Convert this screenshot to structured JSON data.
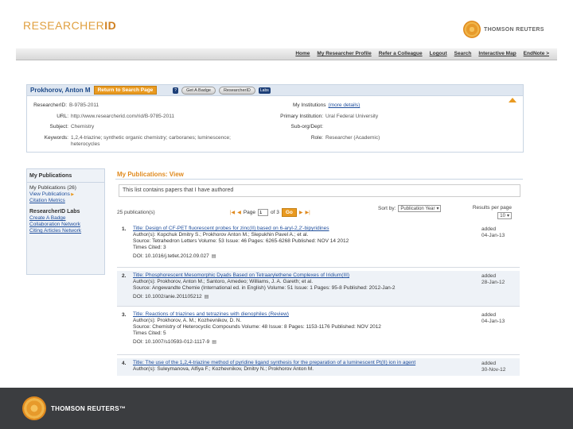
{
  "header": {
    "logo_light": "RESEARCHER",
    "logo_bold": "ID",
    "brand": "THOMSON REUTERS"
  },
  "nav": [
    "Home",
    "My Researcher Profile",
    "Refer a Colleague",
    "Logout",
    "Search",
    "Interactive Map",
    "EndNote >"
  ],
  "profile": {
    "name": "Prokhorov, Anton M",
    "return_button": "Return to Search Page",
    "badge_button": "Get A Badge",
    "download_button": "ResearcherID",
    "labs_label": "Labs",
    "researcher_id_label": "ResearcherID:",
    "researcher_id": "B-9785-2011",
    "url_label": "URL:",
    "url": "http://www.researcherid.com/rid/B-9785-2011",
    "subject_label": "Subject:",
    "subject": "Chemistry",
    "keywords_label": "Keywords:",
    "keywords": "1,2,4-triazine; synthetic organic chemistry; carboranes; luminescence;",
    "keywords_2": "heterocycles",
    "institutions_label": "My Institutions",
    "institutions_more": "(more details)",
    "primary_label": "Primary Institution:",
    "primary": "Ural Federal University",
    "sub_label": "Sub-org/Dept:",
    "sub": "",
    "role_label": "Role:",
    "role": "Researcher (Academic)"
  },
  "sidebar": {
    "title": "My Publications",
    "items": [
      "My Publications (26)",
      "View Publications",
      "Citation Metrics"
    ],
    "labs_title": "ResearcherID Labs",
    "labs_items": [
      "Create A Badge",
      "Collaboration Network",
      "Citing Articles Network"
    ]
  },
  "main": {
    "title": "My Publications: View",
    "note": "This list contains papers that I have authored",
    "count": "25 publication(s)",
    "page_label": "Page",
    "page_value": "1",
    "page_of": "of 3",
    "go": "Go",
    "sort_label": "Sort by:",
    "sort_value": "Publication Year",
    "rpp_label": "Results per page",
    "rpp_value": "10",
    "publications": [
      {
        "num": "1.",
        "title": "Title: Design of CF-PET fluorescent probes for zinc(II) based on 6-aryl-2,2'-bipyridines",
        "authors": "Author(s): Kopchuk Dmitry S.; Prokhorov Anton M.; Slepukhin Pavel A.; et al.",
        "source": "Source: Tetrahedron Letters Volume: 53 Issue: 46 Pages: 6265-6268 Published: NOV 14 2012",
        "cited": "Times Cited: 3",
        "doi": "DOI: 10.1016/j.tetlet.2012.09.027",
        "added_label": "added",
        "added": "04-Jan-13"
      },
      {
        "num": "2.",
        "title": "Title: Phosphorescent Mesomorphic Dyads Based on Tetraarylethene Complexes of Iridium(III)",
        "authors": "Author(s): Prokhorov, Anton M.; Santoro, Amedeo; Williams, J. A. Gareth; et al.",
        "source": "Source: Angewandte Chemie (International ed. in English) Volume: 51 Issue: 1 Pages: 95-8 Published: 2012-Jan-2",
        "cited": "",
        "doi": "DOI: 10.1002/anie.201105212",
        "added_label": "added",
        "added": "28-Jan-12"
      },
      {
        "num": "3.",
        "title": "Title: Reactions of triazines and tetrazines with dienophiles (Review)",
        "authors": "Author(s): Prokhorov, A. M.; Kozhevnikov, D. N.",
        "source": "Source: Chemistry of Heterocyclic Compounds Volume: 48 Issue: 8 Pages: 1153-1176 Published: NOV 2012",
        "cited": "Times Cited: 5",
        "doi": "DOI: 10.1007/s10593-012-1117-9",
        "added_label": "added",
        "added": "04-Jan-13"
      },
      {
        "num": "4.",
        "title": "Title: The use of the 1,2,4-triazine method of pyridine ligand synthesis for the preparation of a luminescent Pt(II) ion in agent",
        "authors": "Author(s): Suleymanova, Alfiya F.; Kozhevnikov, Dmitry N.; Prokhorov Anton M.",
        "source": "",
        "cited": "",
        "doi": "",
        "added_label": "added",
        "added": "30-Nov-12"
      }
    ]
  }
}
